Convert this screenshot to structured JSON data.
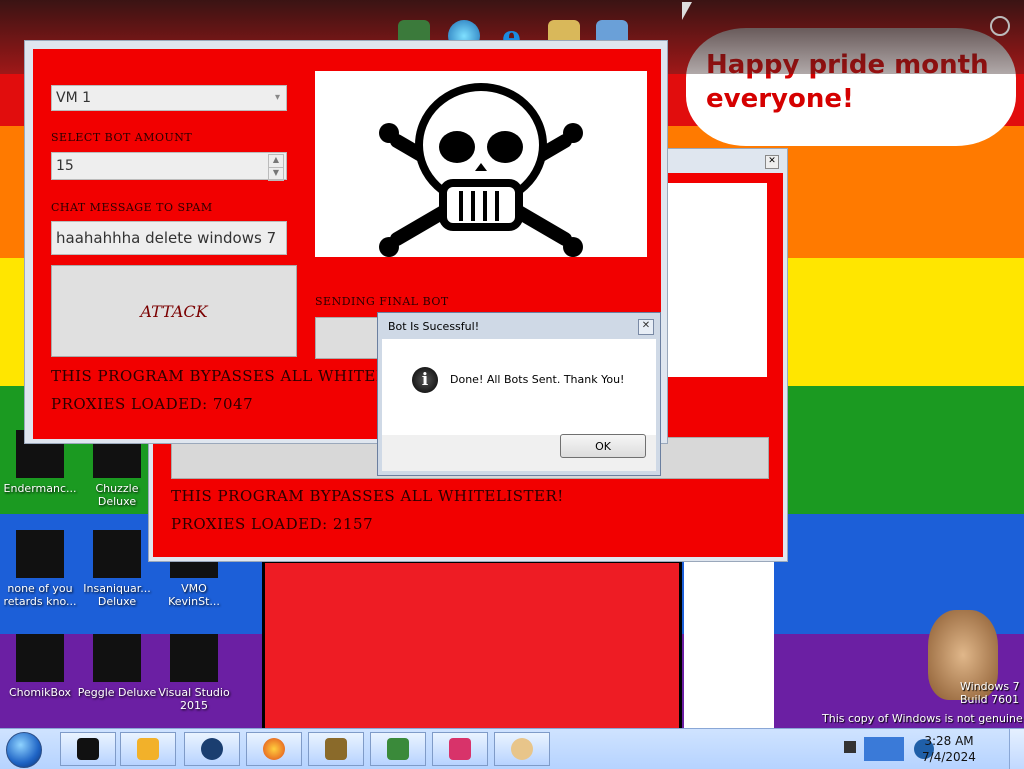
{
  "background": {
    "bands": [
      "#e10d0d",
      "#ff7a00",
      "#ffe600",
      "#1b9a21",
      "#1c5fd8",
      "#6b1fa3"
    ],
    "speech_bubble": {
      "line1": "Happy pride month",
      "line2": "everyone!"
    }
  },
  "top_dock": {
    "icons": [
      "apps-icon",
      "globe-icon",
      "internet-explorer-icon",
      "folder-icon",
      "people-icon"
    ]
  },
  "bot_window_front": {
    "vm_select": {
      "value": "VM 1"
    },
    "bot_amount_label": "SELECT BOT AMOUNT",
    "bot_amount_value": "15",
    "chat_label": "CHAT MESSAGE TO SPAM",
    "chat_value": "haahahhha delete windows 7",
    "attack_label": "ATTACK",
    "sending_label": "SENDING FINAL BOT",
    "bypass_text": "THIS PROGRAM BYPASSES ALL WHITELISTER!",
    "proxies_text": "PROXIES LOADED: 7047"
  },
  "bot_window_back": {
    "bypass_text": "THIS PROGRAM BYPASSES ALL WHITELISTER!",
    "proxies_text": "PROXIES LOADED: 2157"
  },
  "dialog": {
    "title": "Bot Is Sucessful!",
    "message": "Done! All Bots Sent. Thank You!",
    "ok_label": "OK",
    "close_glyph": "✕"
  },
  "desktop_icons": [
    {
      "label": "Endermanc..."
    },
    {
      "label": "Chuzzle Deluxe"
    },
    {
      "label": "none of you retards kno..."
    },
    {
      "label": "Insaniquar... Deluxe"
    },
    {
      "label": "VMO KevinSt..."
    },
    {
      "label": "ChomikBox"
    },
    {
      "label": "Peggle Deluxe"
    },
    {
      "label": "Visual Studio 2015"
    }
  ],
  "watermark": {
    "build_line1": "Windows 7",
    "build_line2": "Build 7601",
    "genuine": "This copy of Windows is not genuine"
  },
  "taskbar": {
    "time": "3:28 AM",
    "date": "7/4/2024"
  }
}
